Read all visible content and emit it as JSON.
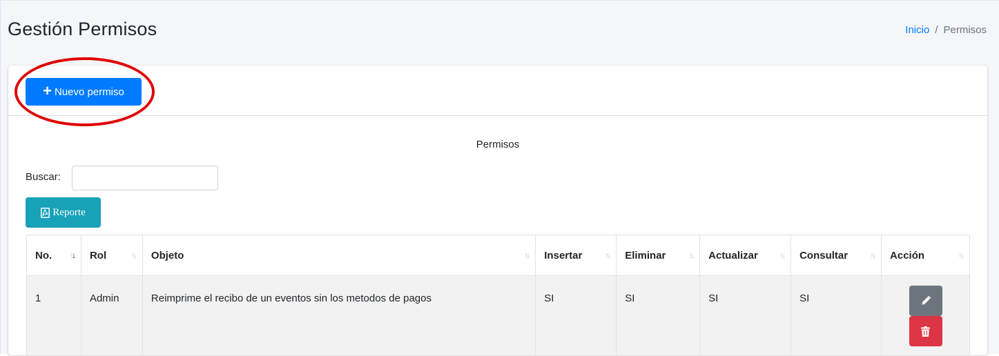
{
  "header": {
    "title": "Gestión Permisos",
    "breadcrumb": {
      "home": "Inicio",
      "separator": "/",
      "current": "Permisos"
    }
  },
  "toolbar": {
    "new_button": "Nuevo permiso",
    "new_icon": "plus-icon"
  },
  "table": {
    "caption": "Permisos",
    "search_label": "Buscar:",
    "search_value": "",
    "report_button": "Reporte",
    "report_icon": "pdf-file-icon",
    "columns": [
      "No.",
      "Rol",
      "Objeto",
      "Insertar",
      "Eliminar",
      "Actualizar",
      "Consultar",
      "Acción"
    ],
    "rows": [
      {
        "no": "1",
        "rol": "Admin",
        "objeto": "Reimprime el recibo de un eventos sin los metodos de pagos",
        "insertar": "SI",
        "eliminar": "SI",
        "actualizar": "SI",
        "consultar": "SI",
        "actions": [
          "edit-icon",
          "trash-icon"
        ]
      }
    ]
  },
  "colors": {
    "primary": "#007bff",
    "info": "#17a2b8",
    "secondary": "#6c757d",
    "danger": "#dc3545",
    "highlight": "#e00000"
  }
}
